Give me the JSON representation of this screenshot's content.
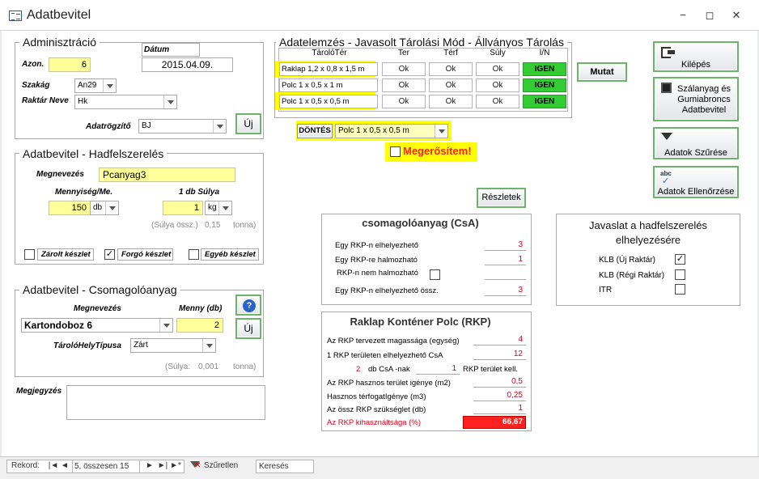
{
  "window": {
    "title": "Adatbevitel",
    "controls": {
      "minimize": "−",
      "restore": "◻",
      "close": "✕"
    }
  },
  "admin": {
    "legend": "Adminisztráció",
    "azon_label": "Azon.",
    "azon_value": "6",
    "datum_label": "Dátum",
    "datum_value": "2015.04.09.",
    "szakag_label": "Szakág",
    "szakag_value": "An29",
    "raktar_label": "Raktár Neve",
    "raktar_value": "Hk",
    "rogzito_label": "Adatrögzítő",
    "rogzito_value": "BJ",
    "new_button": "Új"
  },
  "hadf": {
    "legend": "Adatbevitel - Hadfelszerelés",
    "nev_label": "Megnevezés",
    "nev_value": "Pcanyag3",
    "menny_label": "Mennyiség/Me.",
    "menny_value": "150",
    "menny_unit": "db",
    "suly_label": "1 db Súlya",
    "suly_value": "1",
    "suly_unit": "kg",
    "ossz_label": "(Súlya össz.)",
    "ossz_value": "0,15",
    "ossz_unit": "tonna)",
    "zarolt": "Zárolt készlet",
    "forgo": "Forgó készlet",
    "egyeb": "Egyéb készlet",
    "zarolt_checked": false,
    "forgo_checked": true,
    "egyeb_checked": false,
    "check_mark": "✓"
  },
  "csomag": {
    "legend": "Adatbevitel - Csomagolóanyag",
    "nev_label": "Megnevezés",
    "nev_value": "Kartondoboz 6",
    "menny_label": "Menny (db)",
    "menny_value": "2",
    "tipus_label": "TárolóHelyTípusa",
    "tipus_value": "Zárt",
    "suly_label": "(Súlya:",
    "suly_value": "0,001",
    "suly_unit": "tonna)",
    "help_icon": "?",
    "new_button": "Új"
  },
  "megjegyzes_label": "Megjegyzés",
  "elemzes": {
    "legend": "Adatelemzés - Javasolt Tárolási Mód - Állványos Tárolás",
    "headers": [
      "TárolóTér",
      "Ter",
      "Térf",
      "Súly",
      "I/N"
    ],
    "rows": [
      {
        "name": "Raklap 1,2 x 0,8 x 1,5 m",
        "ter": "Ok",
        "terf": "Ok",
        "suly": "Ok",
        "in": "IGEN"
      },
      {
        "name": "Polc 1 x 0,5 x 1 m",
        "ter": "Ok",
        "terf": "Ok",
        "suly": "Ok",
        "in": "IGEN"
      },
      {
        "name": "Polc 1 x 0,5 x 0,5 m",
        "ter": "Ok",
        "terf": "Ok",
        "suly": "Ok",
        "in": "IGEN"
      }
    ],
    "mutat_button": "Mutat",
    "dontes_label": "DÖNTÉS",
    "dontes_value": "Polc 1 x 0,5 x 0,5 m",
    "megerosit_label": "Megerősítem!",
    "reszletek_button": "Részletek"
  },
  "csa": {
    "title": "csomagolóanyag (CsA)",
    "rows": [
      {
        "label": "Egy RKP-n elhelyezhető",
        "value": "3"
      },
      {
        "label": "Egy RKP-re halmozható",
        "value": "1"
      },
      {
        "label": "RKP-n nem halmozható",
        "value": ""
      },
      {
        "label": "Egy RKP-n elhelyezhető össz.",
        "value": "3"
      }
    ]
  },
  "rkp": {
    "title": "Raklap Konténer Polc (RKP)",
    "rows": [
      {
        "label": "Az RKP tervezett magassága (egység)",
        "value": "4"
      },
      {
        "label": "1 RKP területen elhelyezhető CsA",
        "value": "12"
      },
      {
        "label": "Az RKP hasznos terület igénye (m2)",
        "value": "0,5"
      },
      {
        "label": "Hasznos térfogatIgénye (m3)",
        "value": "0,25"
      },
      {
        "label": "Az össz RKP szükséglet (db)",
        "value": "1"
      },
      {
        "label": "Az RKP kihasználtsága (%)",
        "value": "66,67"
      }
    ],
    "cs_left": "2",
    "cs_mid": "db CsA -nak",
    "cs_val": "1",
    "cs_right": "RKP terület kell."
  },
  "javaslat": {
    "title": "Javaslat a hadfelszerelés elhelyezésére",
    "items": [
      {
        "label": "KLB (Új Raktár)",
        "checked": true
      },
      {
        "label": "KLB (Régi Raktár)",
        "checked": false
      },
      {
        "label": "ITR",
        "checked": false
      }
    ]
  },
  "side_buttons": {
    "kilepes": "Kilépés",
    "szalanyag": "Szálanyag és Gumiabroncs Adatbevitel",
    "szures": "Adatok Szűrése",
    "ellenorzes": "Adatok Ellenőrzése"
  },
  "statusbar": {
    "rekord_label": "Rekord:",
    "nav_first": "|◄",
    "nav_prev": "◄",
    "record_text": "5, összesen 15",
    "nav_next": "►",
    "nav_last": "►|",
    "nav_new": "►*",
    "filter_text": "Szűretlen",
    "search_text": "Keresés"
  },
  "colors": {
    "highlight": "#ffff00",
    "igen_green": "#33cc33",
    "value_red": "#e0001b",
    "alert_red": "#ff2020"
  }
}
